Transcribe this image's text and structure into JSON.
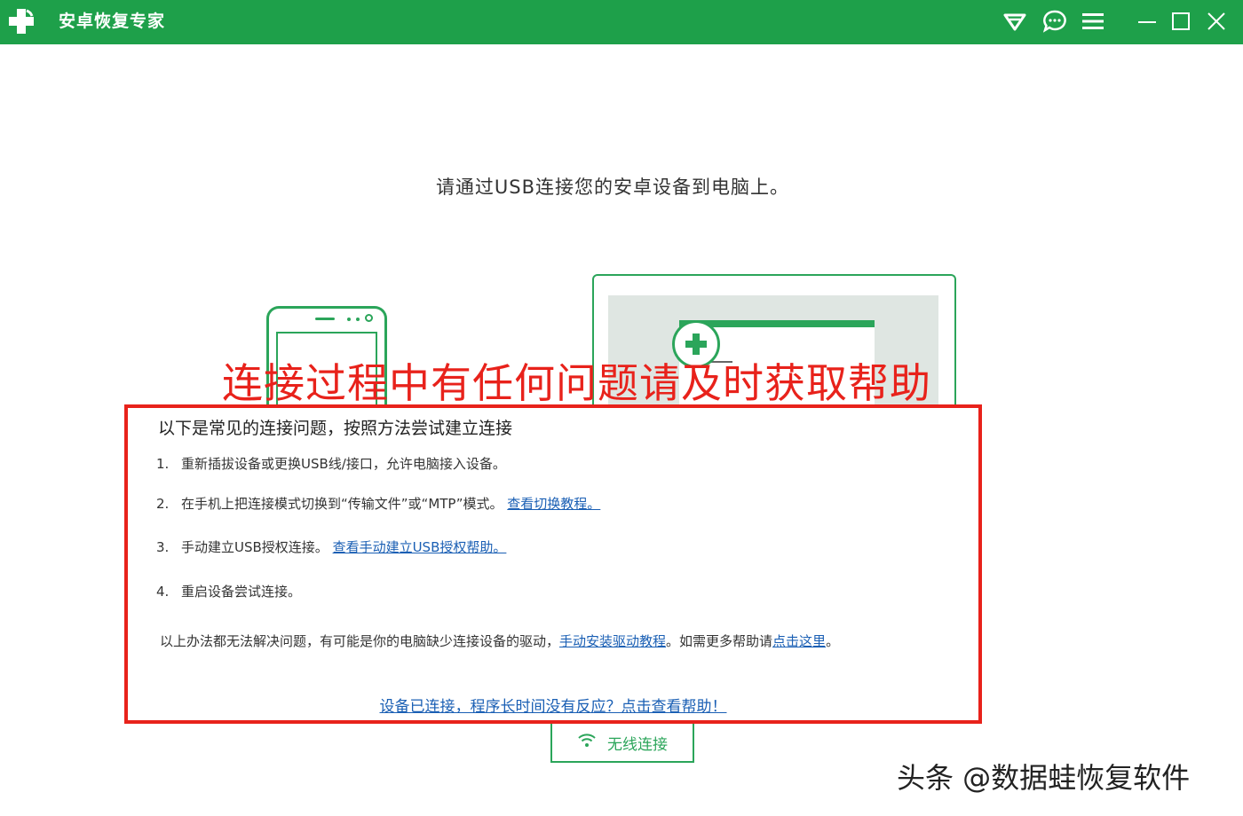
{
  "app": {
    "title": "安卓恢复专家"
  },
  "titlebar": {
    "icons": [
      "vip-diamond-icon",
      "chat-bubble-icon",
      "menu-icon",
      "minimize-icon",
      "maximize-icon",
      "close-icon"
    ],
    "color": "#1ea04a"
  },
  "main": {
    "instruction": "请通过USB连接您的安卓设备到电脑上。"
  },
  "overlay": {
    "heading": "连接过程中有任何问题请及时获取帮助",
    "color": "#e8221b"
  },
  "help": {
    "heading": "以下是常见的连接问题，按照方法尝试建立连接",
    "items": [
      {
        "num": "1.",
        "text": "重新插拔设备或更换USB线/接口，允许电脑接入设备。"
      },
      {
        "num": "2.",
        "text": "在手机上把连接模式切换到“传输文件”或“MTP”模式。",
        "link": "查看切换教程。"
      },
      {
        "num": "3.",
        "text": "手动建立USB授权连接。",
        "link": "查看手动建立USB授权帮助。"
      },
      {
        "num": "4.",
        "text": "重启设备尝试连接。"
      }
    ],
    "footer": {
      "text_before": "以上办法都无法解决问题，有可能是你的电脑缺少连接设备的驱动，",
      "link1": "手动安装驱动教程",
      "text_middle": "。如需更多帮助请",
      "link2": "点击这里",
      "text_after": "。"
    },
    "bottom_link": "设备已连接，程序长时间没有反应？点击查看帮助！"
  },
  "wireless": {
    "label": "无线连接"
  },
  "watermark": {
    "text": "头条 @数据蛙恢复软件"
  },
  "colors": {
    "accent": "#2ba55a",
    "link": "#1a5fb4",
    "highlight": "#e8221b"
  }
}
